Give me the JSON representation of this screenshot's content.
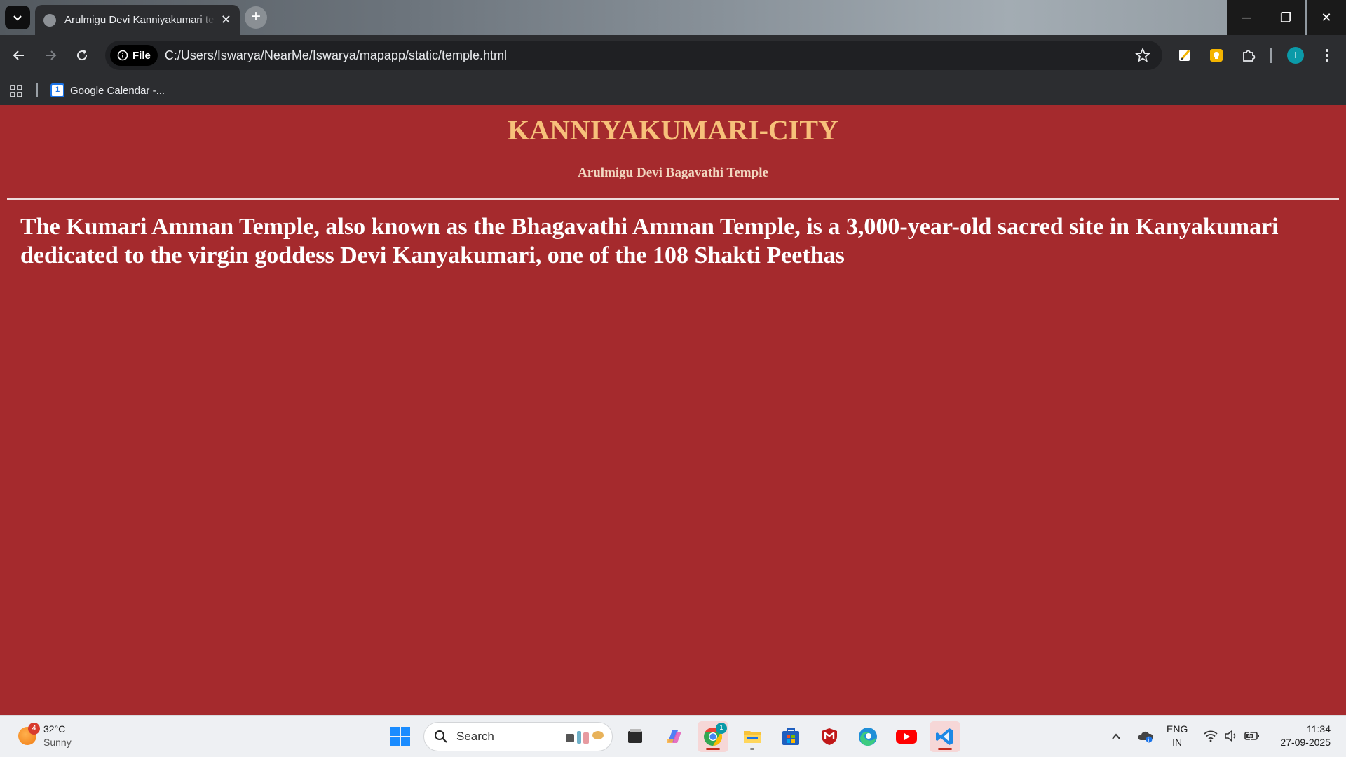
{
  "browser": {
    "tab_title": "Arulmigu Devi Kanniyakumari temple",
    "new_tab_symbol": "+",
    "close_tab_symbol": "✕",
    "window_controls": {
      "minimize": "─",
      "restore": "❐",
      "close": "✕"
    },
    "address": {
      "scheme_chip": "File",
      "url": "C:/Users/Iswarya/NearMe/Iswarya/mapapp/static/temple.html"
    },
    "profile_initial": "I",
    "bookmarks": [
      {
        "label": "Google Calendar -...",
        "icon": "google-calendar-icon",
        "icon_text": "1"
      }
    ]
  },
  "page": {
    "title": "KANNIYAKUMARI-CITY",
    "subtitle": "Arulmigu Devi Bagavathi Temple",
    "body": "The Kumari Amman Temple, also known as the Bhagavathi Amman Temple, is a 3,000-year-old sacred site in Kanyakumari dedicated to the virgin goddess Devi Kanyakumari, one of the 108 Shakti Peethas",
    "colors": {
      "background": "#a52a2d",
      "title": "#f7c07a",
      "text": "#ffffff"
    }
  },
  "taskbar": {
    "weather": {
      "temp": "32°C",
      "condition": "Sunny",
      "badge": "4"
    },
    "search_label": "Search",
    "chrome_badge": "1",
    "tray": {
      "lang_top": "ENG",
      "lang_bottom": "IN",
      "time": "11:34",
      "date": "27-09-2025"
    }
  }
}
